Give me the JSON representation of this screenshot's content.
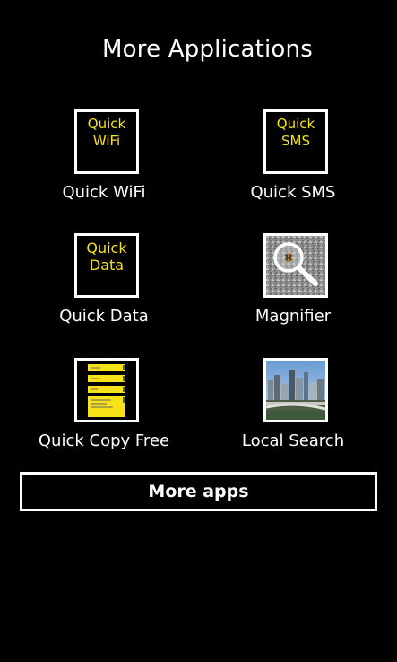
{
  "page": {
    "title": "More Applications"
  },
  "apps": [
    {
      "label": "Quick WiFi",
      "tile_lines": [
        "Quick",
        "WiFi"
      ],
      "icon": "quick-wifi-icon"
    },
    {
      "label": "Quick SMS",
      "tile_lines": [
        "Quick",
        "SMS"
      ],
      "icon": "quick-sms-icon"
    },
    {
      "label": "Quick Data",
      "tile_lines": [
        "Quick",
        "Data"
      ],
      "icon": "quick-data-icon"
    },
    {
      "label": "Magnifier",
      "icon": "magnifier-icon"
    },
    {
      "label": "Quick Copy Free",
      "icon": "quick-copy-icon"
    },
    {
      "label": "Local Search",
      "icon": "city-skyline-icon"
    }
  ],
  "more_button": {
    "label": "More apps"
  },
  "colors": {
    "background": "#000000",
    "text": "#ffffff",
    "tile_text": "#f7e21a",
    "border": "#ffffff"
  }
}
